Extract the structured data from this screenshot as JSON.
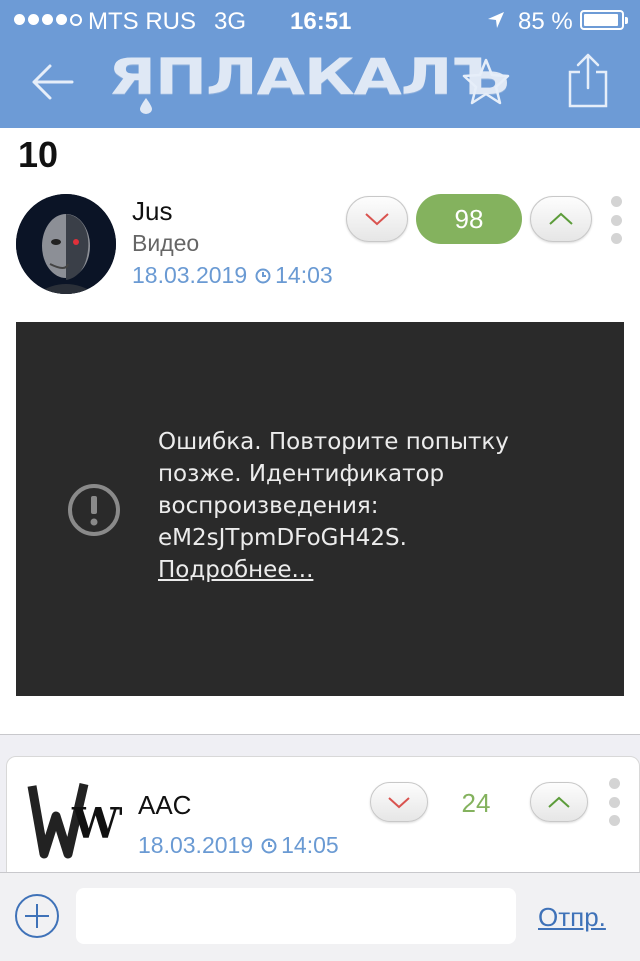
{
  "status_bar": {
    "carrier": "MTS RUS",
    "network": "3G",
    "time": "16:51",
    "battery": "85 %",
    "signal_bars": 4
  },
  "nav": {
    "logo_text": "ЯПЛАКАЛЪ",
    "back_icon": "back-arrow-icon",
    "favorite_icon": "star-icon",
    "share_icon": "share-icon"
  },
  "post": {
    "number": "10",
    "author": "Jus",
    "category": "Видео",
    "date": "18.03.2019",
    "time": "14:03",
    "score": "98",
    "video_error": {
      "message": "Ошибка. Повторите попытку позже. Идентификатор воспроизведения: eM2sJTpmDFoGH42S.",
      "link": "Подробнее..."
    }
  },
  "comment": {
    "author": "AAC",
    "date": "18.03.2019",
    "time": "14:05",
    "score": "24",
    "avatar_caption": "WTF"
  },
  "composer": {
    "input_value": "",
    "send_label": "Отпр."
  },
  "colors": {
    "header": "#6d9bd6",
    "score_green": "#84b25e",
    "link_blue": "#6a9ad3",
    "video_bg": "#2a2a2a"
  }
}
